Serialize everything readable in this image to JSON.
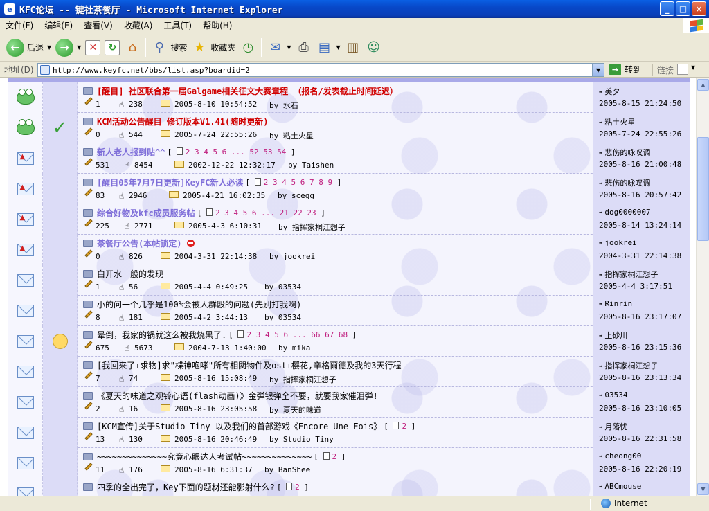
{
  "window": {
    "title": "KFC论坛 -- 键社茶餐厅 - Microsoft Internet Explorer",
    "buttons": [
      "_",
      "□",
      "×"
    ]
  },
  "menu": [
    "文件(F)",
    "编辑(E)",
    "查看(V)",
    "收藏(A)",
    "工具(T)",
    "帮助(H)"
  ],
  "toolbar": {
    "back_label": "后退",
    "search_label": "搜索",
    "favorites_label": "收藏夹"
  },
  "address": {
    "label": "地址(D)",
    "url": "http://www.keyfc.net/bbs/list.asp?boardid=2",
    "go_label": "转到",
    "links_label": "链接"
  },
  "threads": [
    {
      "icon": "frog-icon",
      "mark": "",
      "title": "[醒目]  社区联合第一届Galgame相关征文大赛章程 （报名/发表截止时间延迟）",
      "style": "red",
      "pages": "",
      "locked": false,
      "replies": "1",
      "views": "238",
      "date": "2005-8-10 10:54:52",
      "author": "by 水石",
      "last_user": "美夕",
      "last_time": "2005-8-15 21:24:50"
    },
    {
      "icon": "frog-icon",
      "mark": "check",
      "title": "KCM活动公告醒目 修订版本V1.41(随时更新)",
      "style": "red",
      "pages": "",
      "locked": false,
      "replies": "0",
      "views": "544",
      "date": "2005-7-24 22:55:26",
      "author": "by 粘土火星",
      "last_user": "粘土火星",
      "last_time": "2005-7-24 22:55:26"
    },
    {
      "icon": "hot-envelope-icon",
      "mark": "",
      "title": "新人老人报到贴^^",
      "style": "purple",
      "pages": "2 3 4 5 6 ... 52 53 54",
      "locked": false,
      "replies": "531",
      "views": "8454",
      "date": "2002-12-22 12:32:17",
      "author": "by Taishen",
      "last_user": "悲伤的咏叹调",
      "last_time": "2005-8-16 21:00:48"
    },
    {
      "icon": "hot-envelope-icon",
      "mark": "",
      "title": "[醒目05年7月7日更新]KeyFC新人必读",
      "style": "purple",
      "pages": "2 3 4 5 6 7 8 9",
      "locked": false,
      "replies": "83",
      "views": "2946",
      "date": "2005-4-21 16:02:35",
      "author": "by scegg",
      "last_user": "悲伤的咏叹调",
      "last_time": "2005-8-16 20:57:42"
    },
    {
      "icon": "hot-envelope-icon",
      "mark": "",
      "title": "综合好物及kfc成员服务帖",
      "style": "purple",
      "pages": "2 3 4 5 6 ... 21 22 23",
      "locked": false,
      "replies": "225",
      "views": "2771",
      "date": "2005-4-3 6:10:31",
      "author": "by 指挥家桐江想子",
      "last_user": "dog0000007",
      "last_time": "2005-8-14 13:24:14"
    },
    {
      "icon": "hot-envelope-icon",
      "mark": "",
      "title": "茶餐厅公告(本帖锁定)",
      "style": "purple",
      "pages": "",
      "locked": true,
      "replies": "0",
      "views": "826",
      "date": "2004-3-31 22:14:38",
      "author": "by jookrei",
      "last_user": "jookrei",
      "last_time": "2004-3-31 22:14:38"
    },
    {
      "icon": "envelope-icon",
      "mark": "",
      "title": "白开水一般的发现",
      "style": "black",
      "pages": "",
      "locked": false,
      "replies": "1",
      "views": "56",
      "date": "2005-4-4 0:49:25",
      "author": "by 03534",
      "last_user": "指挥家桐江想子",
      "last_time": "2005-4-4 3:17:51"
    },
    {
      "icon": "envelope-icon",
      "mark": "",
      "title": "小的问一个几乎是100%会被人群殴的问题(先别打我啊)",
      "style": "black",
      "pages": "",
      "locked": false,
      "replies": "8",
      "views": "181",
      "date": "2005-4-2 3:44:13",
      "author": "by 03534",
      "last_user": "Rinrin",
      "last_time": "2005-8-16 23:17:07"
    },
    {
      "icon": "envelope-icon",
      "mark": "smiley",
      "title": "晕倒，我家的锅就这么被我烧黑了.",
      "style": "black",
      "pages": "2 3 4 5 6 ... 66 67 68",
      "locked": false,
      "replies": "675",
      "views": "5673",
      "date": "2004-7-13 1:40:00",
      "author": "by mika",
      "last_user": "上砂川",
      "last_time": "2005-8-16 23:15:36"
    },
    {
      "icon": "envelope-icon",
      "mark": "",
      "title": "[我回来了+求物]求\"楪神咆哮\"所有相関物件及ost+樱花,辛格爾德及我的3天行程",
      "style": "black",
      "pages": "",
      "locked": false,
      "replies": "7",
      "views": "74",
      "date": "2005-8-16 15:08:49",
      "author": "by 指挥家桐江想子",
      "last_user": "指挥家桐江想子",
      "last_time": "2005-8-16 23:13:34"
    },
    {
      "icon": "envelope-icon",
      "mark": "",
      "title": "《夏天的味道之观铃心语(flash动画)》金弹银弹全不要，就要我家催泪弹!",
      "style": "black",
      "pages": "",
      "locked": false,
      "replies": "2",
      "views": "16",
      "date": "2005-8-16 23:05:58",
      "author": "by 夏天的味道",
      "last_user": "03534",
      "last_time": "2005-8-16 23:10:05"
    },
    {
      "icon": "envelope-icon",
      "mark": "",
      "title": "[KCM宣传]关于Studio Tiny 以及我们的首部游戏《Encore Une Fois》",
      "style": "black",
      "pages": "2",
      "locked": false,
      "replies": "13",
      "views": "130",
      "date": "2005-8-16 20:46:49",
      "author": "by Studio Tiny",
      "last_user": "月落忧",
      "last_time": "2005-8-16 22:31:58"
    },
    {
      "icon": "envelope-icon",
      "mark": "",
      "title": "~~~~~~~~~~~~~~究竟心眼达人考试帖~~~~~~~~~~~~~~",
      "style": "black",
      "pages": "2",
      "locked": false,
      "replies": "11",
      "views": "176",
      "date": "2005-8-16 6:31:37",
      "author": "by BanShee",
      "last_user": "cheong00",
      "last_time": "2005-8-16 22:20:19"
    },
    {
      "icon": "envelope-icon",
      "mark": "",
      "title": "四季的全出完了，Key下面的题材还能影射什么?",
      "style": "black",
      "pages": "2",
      "locked": false,
      "replies": "",
      "views": "",
      "date": "",
      "author": "",
      "last_user": "ABCmouse",
      "last_time": ""
    }
  ],
  "status": {
    "zone": "Internet"
  },
  "colors": {
    "title_red": "#d00000",
    "title_purple": "#7f6fd9",
    "page_link": "#c0207f",
    "xp_blue": "#0a5fe3"
  }
}
